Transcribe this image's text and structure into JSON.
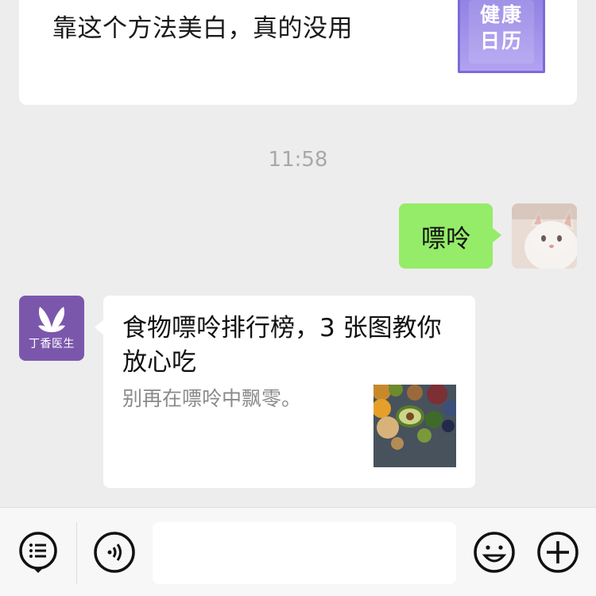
{
  "top_card": {
    "title": "靠这个方法美白，真的没用",
    "thumb_text_line1": "健康",
    "thumb_text_line2": "日历"
  },
  "timestamp": "11:58",
  "sent_message": {
    "text": "嘌呤"
  },
  "received_article": {
    "sender_brand": "丁香医生",
    "title": "食物嘌呤排行榜，3 张图教你放心吃",
    "description": "别再在嘌呤中飘零。"
  },
  "toolbar": {
    "menu_icon": "list-menu-icon",
    "voice_icon": "voice-icon",
    "emoji_icon": "emoji-icon",
    "add_icon": "plus-icon",
    "input_value": ""
  },
  "colors": {
    "background": "#ededed",
    "sent_bubble": "#95ec69",
    "brand_purple": "#7b57ac",
    "timestamp_gray": "#a8a8a8"
  }
}
